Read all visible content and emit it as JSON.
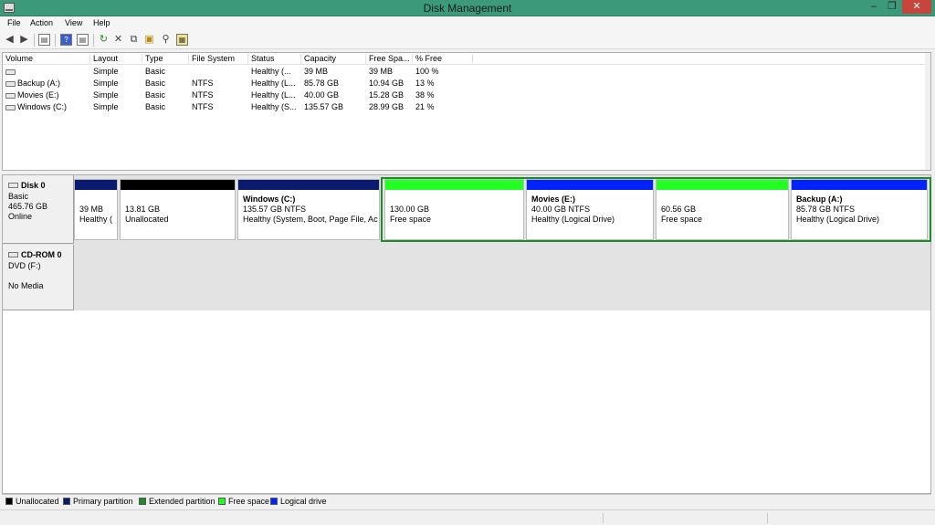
{
  "window": {
    "title": "Disk Management"
  },
  "menu": [
    "File",
    "Action",
    "View",
    "Help"
  ],
  "volume_list": {
    "columns": [
      "Volume",
      "Layout",
      "Type",
      "File System",
      "Status",
      "Capacity",
      "Free Spa...",
      "% Free"
    ],
    "rows": [
      [
        "",
        "Simple",
        "Basic",
        "",
        "Healthy (...",
        "39 MB",
        "39 MB",
        "100 %"
      ],
      [
        "Backup (A:)",
        "Simple",
        "Basic",
        "NTFS",
        "Healthy (L...",
        "85.78 GB",
        "10.94 GB",
        "13 %"
      ],
      [
        "Movies (E:)",
        "Simple",
        "Basic",
        "NTFS",
        "Healthy (L...",
        "40.00 GB",
        "15.28 GB",
        "38 %"
      ],
      [
        "Windows (C:)",
        "Simple",
        "Basic",
        "NTFS",
        "Healthy (S...",
        "135.57 GB",
        "28.99 GB",
        "21 %"
      ]
    ]
  },
  "disk0": {
    "name": "Disk 0",
    "type": "Basic",
    "size": "465.76 GB",
    "state": "Online",
    "partitions": [
      {
        "label": "",
        "size": "39 MB",
        "status": "Healthy (",
        "color": "#0a1a6e"
      },
      {
        "label": "",
        "size": "13.81 GB",
        "status": "Unallocated",
        "color": "#000000"
      },
      {
        "label": "Windows  (C:)",
        "size": "135.57 GB NTFS",
        "status": "Healthy (System, Boot, Page File, Acti",
        "color": "#0a1a6e"
      },
      {
        "label": "",
        "size": "130.00 GB",
        "status": "Free space",
        "color": "#22ff22"
      },
      {
        "label": "Movies  (E:)",
        "size": "40.00 GB NTFS",
        "status": "Healthy (Logical Drive)",
        "color": "#0022ff"
      },
      {
        "label": "",
        "size": "60.56 GB",
        "status": "Free space",
        "color": "#22ff22"
      },
      {
        "label": "Backup  (A:)",
        "size": "85.78 GB NTFS",
        "status": "Healthy (Logical Drive)",
        "color": "#0022ff"
      }
    ]
  },
  "cdrom0": {
    "name": "CD-ROM 0",
    "drive": "DVD (F:)",
    "media": "No Media"
  },
  "legend": [
    {
      "label": "Unallocated",
      "color": "#000000"
    },
    {
      "label": "Primary partition",
      "color": "#0a1a6e"
    },
    {
      "label": "Extended partition",
      "color": "#1f8b26"
    },
    {
      "label": "Free space",
      "color": "#22ff22"
    },
    {
      "label": "Logical drive",
      "color": "#0022ff"
    }
  ]
}
